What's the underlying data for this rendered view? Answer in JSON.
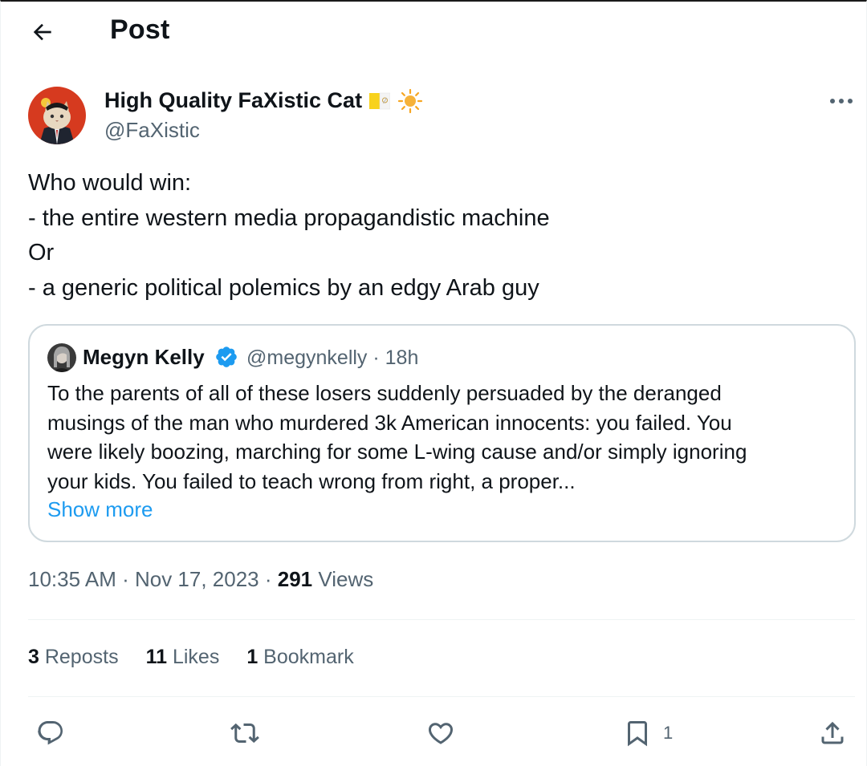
{
  "header": {
    "title": "Post",
    "back_icon": "arrow-left-icon"
  },
  "author": {
    "display_name": "High Quality FaXistic Cat",
    "handle": "@FaXistic",
    "emoji_icons": [
      "vatican-flag-icon",
      "sun-icon"
    ],
    "more_icon": "more-horizontal-icon"
  },
  "post": {
    "lines": [
      "Who would win:",
      "- the entire western media propagandistic machine",
      "Or",
      "- a generic political polemics by an edgy Arab guy"
    ]
  },
  "quote": {
    "name": "Megyn Kelly",
    "verified_icon": "verified-badge-icon",
    "meta": "@megynkelly · 18h",
    "lines": [
      "To the parents of all of these losers suddenly persuaded by the deranged",
      "musings of the man who murdered 3k American innocents: you failed. You",
      "were likely boozing, marching for some L-wing cause and/or simply ignoring",
      "your kids. You failed to teach wrong from right, a proper..."
    ],
    "show_more": "Show more"
  },
  "timestamp": {
    "time": "10:35 AM",
    "sep1": " · ",
    "date": "Nov 17, 2023",
    "sep2": " · ",
    "views_count": "291",
    "views_label": " Views"
  },
  "stats": {
    "reposts_count": "3",
    "reposts_label": " Reposts",
    "likes_count": "11",
    "likes_label": " Likes",
    "bookmarks_count": "1",
    "bookmarks_label": " Bookmark"
  },
  "actions": {
    "reply_icon": "reply-icon",
    "repost_icon": "repost-icon",
    "like_icon": "heart-icon",
    "bookmark_icon": "bookmark-icon",
    "bookmark_count": "1",
    "share_icon": "share-icon"
  },
  "colors": {
    "text": "#0f1419",
    "secondary": "#536471",
    "link": "#1d9bf0",
    "border": "#cfd9de"
  }
}
